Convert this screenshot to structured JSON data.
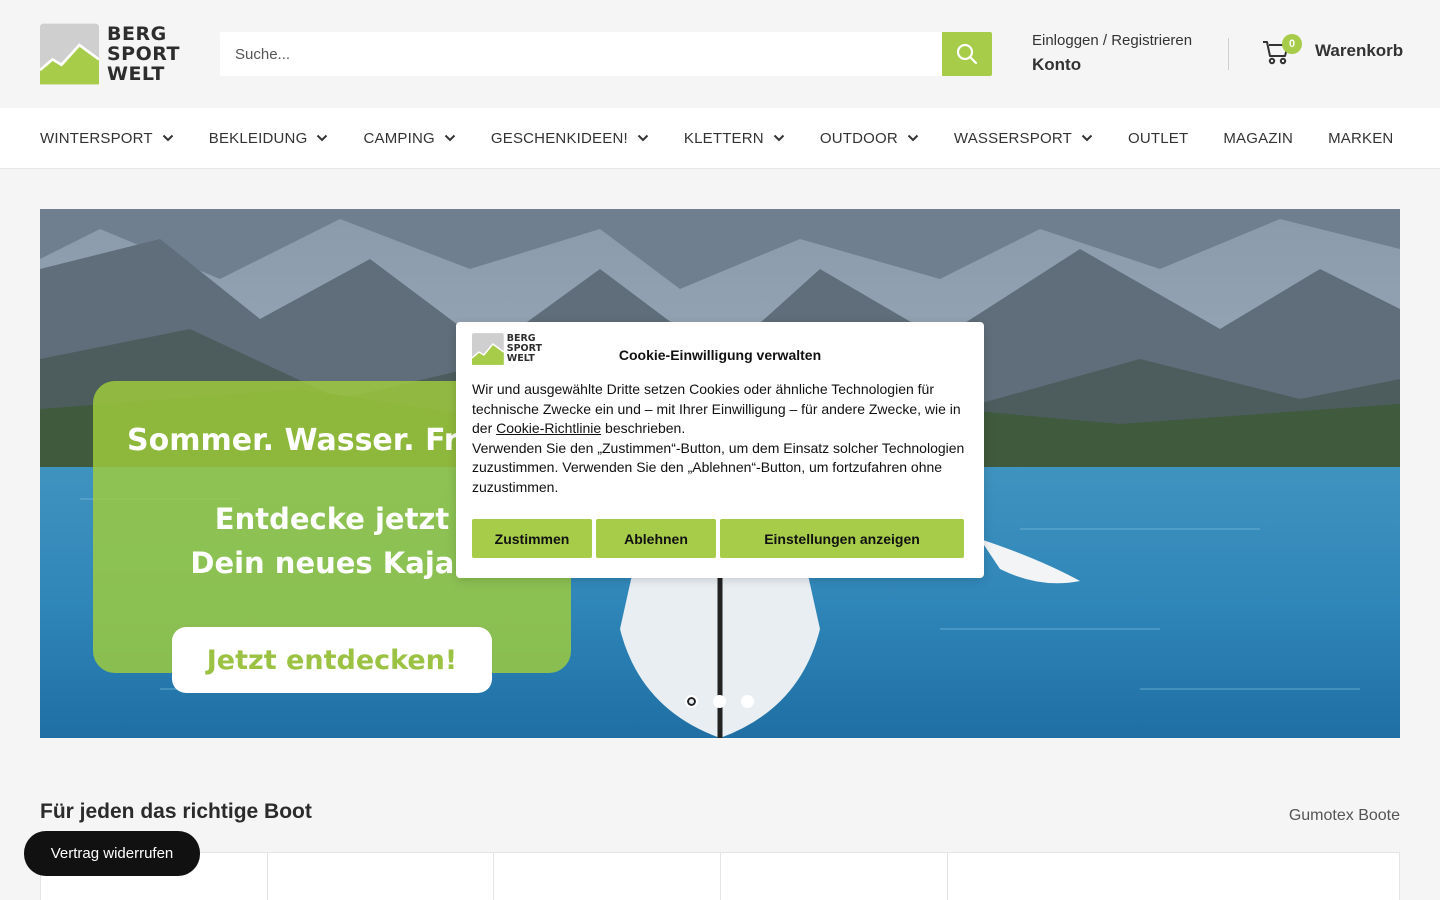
{
  "header": {
    "logo_lines": [
      "BERG",
      "SPORT",
      "WELT"
    ],
    "search_placeholder": "Suche...",
    "login_label": "Einloggen / Registrieren",
    "account_label": "Konto",
    "cart_count": "0",
    "cart_label": "Warenkorb"
  },
  "nav": {
    "items": [
      {
        "label": "WINTERSPORT",
        "has_dropdown": true
      },
      {
        "label": "BEKLEIDUNG",
        "has_dropdown": true
      },
      {
        "label": "CAMPING",
        "has_dropdown": true
      },
      {
        "label": "GESCHENKIDEEN!",
        "has_dropdown": true
      },
      {
        "label": "KLETTERN",
        "has_dropdown": true
      },
      {
        "label": "OUTDOOR",
        "has_dropdown": true
      },
      {
        "label": "WASSERSPORT",
        "has_dropdown": true
      },
      {
        "label": "OUTLET",
        "has_dropdown": false
      },
      {
        "label": "MAGAZIN",
        "has_dropdown": false
      },
      {
        "label": "MARKEN",
        "has_dropdown": false
      }
    ]
  },
  "hero": {
    "headline": "Sommer. Wasser. Fre",
    "line1": "Entdecke jetzt",
    "line2": "Dein neues Kajak",
    "cta": "Jetzt entdecken!",
    "slide_count": 3,
    "active_slide": 1
  },
  "section": {
    "title": "Für jeden das richtige Boot",
    "link": "Gumotex Boote"
  },
  "revoke_label": "Vertrag widerrufen",
  "cookie": {
    "logo_lines": [
      "BERG",
      "SPORT",
      "WELT"
    ],
    "title": "Cookie-Einwilligung verwalten",
    "text_before_link": "Wir und ausgewählte Dritte setzen Cookies oder ähnliche Technologien für technische Zwecke ein und – mit Ihrer Einwilligung – für andere Zwecke, wie in der ",
    "link": "Cookie-Richtlinie",
    "text_after_link": " beschrieben.",
    "text2": "Verwenden Sie den „Zustimmen“-Button, um dem Einsatz solcher Technologien zuzustimmen. Verwenden Sie den „Ablehnen“-Button, um fortzufahren ohne zuzustimmen.",
    "accept": "Zustimmen",
    "reject": "Ablehnen",
    "settings": "Einstellungen anzeigen"
  },
  "colors": {
    "brand_green": "#a6cc4a",
    "text_dark": "#2b2b2b",
    "background": "#f5f5f5"
  }
}
